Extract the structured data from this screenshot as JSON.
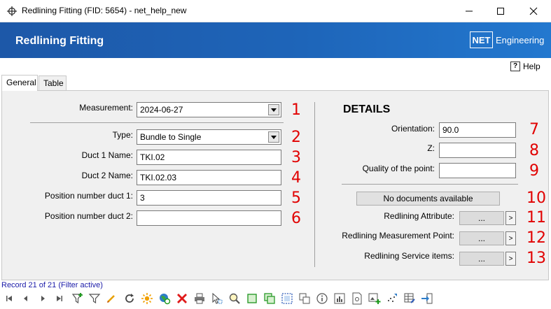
{
  "window": {
    "title": "Redlining Fitting (FID: 5654) - net_help_new",
    "icons": [
      "move-icon",
      "minimize-icon",
      "maximize-icon",
      "close-icon"
    ]
  },
  "header": {
    "title": "Redlining Fitting",
    "logo_box": "NET",
    "logo_text": "Engineering",
    "colors": {
      "band": "#1e65b9",
      "text": "#ffffff"
    }
  },
  "help": {
    "label": "Help",
    "icon": "?"
  },
  "tabs": [
    {
      "label": "General",
      "active": true
    },
    {
      "label": "Table",
      "active": false
    }
  ],
  "general": {
    "measurement": {
      "label": "Measurement:",
      "value": "2024-06-27",
      "num": "1"
    },
    "type": {
      "label": "Type:",
      "value": "Bundle to Single",
      "num": "2"
    },
    "duct1": {
      "label": "Duct 1 Name:",
      "value": "TKI.02",
      "num": "3"
    },
    "duct2": {
      "label": "Duct 2 Name:",
      "value": "TKI.02.03",
      "num": "4"
    },
    "pos1": {
      "label": "Position number duct 1:",
      "value": "3",
      "num": "5"
    },
    "pos2": {
      "label": "Position number duct 2:",
      "value": "",
      "num": "6"
    }
  },
  "details": {
    "title": "DETAILS",
    "orientation": {
      "label": "Orientation:",
      "value": "90.0",
      "num": "7"
    },
    "z": {
      "label": "Z:",
      "value": "",
      "num": "8"
    },
    "quality": {
      "label": "Quality of the point:",
      "value": "",
      "num": "9"
    },
    "documents": {
      "label": "No documents available",
      "num": "10"
    },
    "attribute": {
      "label": "Redlining Attribute:",
      "button": "...",
      "arrow": ">",
      "num": "11"
    },
    "measurement_point": {
      "label": "Redlining Measurement Point:",
      "button": "...",
      "arrow": ">",
      "num": "12"
    },
    "service_items": {
      "label": "Redlining Service items:",
      "button": "...",
      "arrow": ">",
      "num": "13"
    },
    "annotation_color": "#e10000"
  },
  "status": {
    "record": "Record 21 of 21 (Filter active)"
  },
  "toolbar_icons": [
    "first-record-icon",
    "previous-record-icon",
    "next-record-icon",
    "last-record-icon",
    "add-filter-icon",
    "filter-icon",
    "edit-icon",
    "refresh-icon",
    "highlight-icon",
    "globe-refresh-icon",
    "delete-icon",
    "print-icon",
    "select-pointer-icon",
    "zoom-icon",
    "copy-green-icon",
    "duplicate-green-icon",
    "select-area-icon",
    "copy-icon",
    "info-icon",
    "chart-icon",
    "document-icon",
    "add-image-icon",
    "scatter-icon",
    "table-edit-icon",
    "exit-icon"
  ]
}
